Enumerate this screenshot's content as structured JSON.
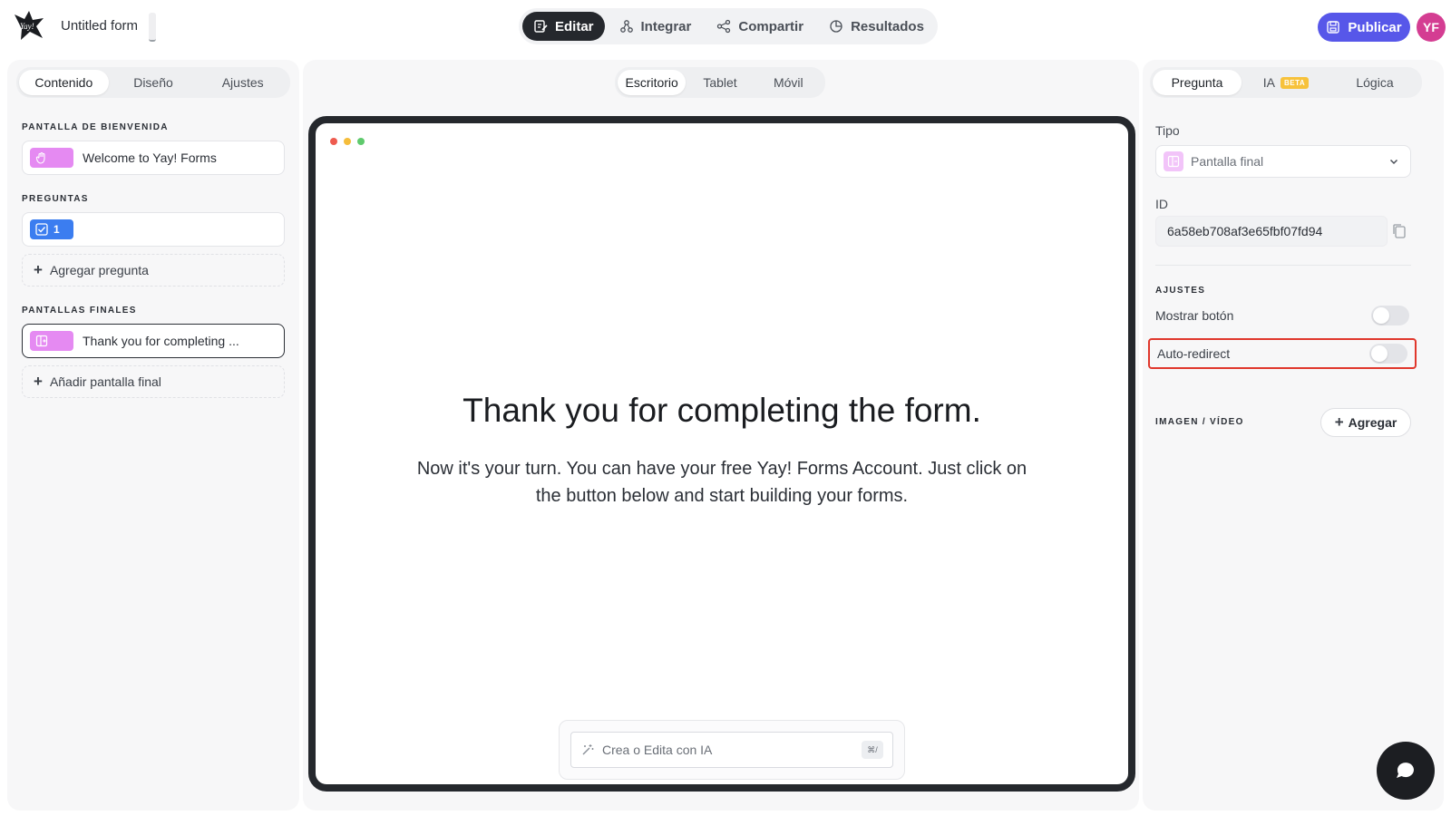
{
  "app": {
    "form_title": "Untitled form"
  },
  "header": {
    "tabs": [
      {
        "label": "Editar",
        "icon": "edit-icon",
        "active": true
      },
      {
        "label": "Integrar",
        "icon": "integrate-icon",
        "active": false
      },
      {
        "label": "Compartir",
        "icon": "share-icon",
        "active": false
      },
      {
        "label": "Resultados",
        "icon": "results-icon",
        "active": false
      }
    ],
    "publish_label": "Publicar",
    "avatar_initials": "YF"
  },
  "left_panel": {
    "tabs": [
      {
        "label": "Contenido",
        "active": true
      },
      {
        "label": "Diseño",
        "active": false
      },
      {
        "label": "Ajustes",
        "active": false
      }
    ],
    "welcome_section": {
      "label": "PANTALLA DE BIENVENIDA",
      "item": "Welcome to Yay! Forms"
    },
    "questions_section": {
      "label": "PREGUNTAS",
      "items": [
        {
          "number": "1",
          "text": ""
        }
      ],
      "add_label": "Agregar pregunta"
    },
    "end_section": {
      "label": "PANTALLAS FINALES",
      "item": "Thank you for completing ...",
      "add_label": "Añadir pantalla final"
    }
  },
  "center": {
    "device_tabs": [
      {
        "label": "Escritorio",
        "active": true
      },
      {
        "label": "Tablet",
        "active": false
      },
      {
        "label": "Móvil",
        "active": false
      }
    ],
    "preview": {
      "heading": "Thank you for completing the form.",
      "body": "Now it's your turn. You can have your free Yay! Forms Account. Just click on the button below and start building your forms."
    },
    "ai_input": {
      "placeholder": "Crea o Edita con IA",
      "shortcut": "⌘/"
    }
  },
  "right_panel": {
    "tabs": [
      {
        "label": "Pregunta",
        "active": true
      },
      {
        "label": "IA",
        "badge": "BETA",
        "active": false
      },
      {
        "label": "Lógica",
        "active": false
      }
    ],
    "type_label": "Tipo",
    "type_value": "Pantalla final",
    "id_label": "ID",
    "id_value": "6a58eb708af3e65fbf07fd94",
    "settings_label": "AJUSTES",
    "toggles": [
      {
        "label": "Mostrar botón",
        "on": false
      },
      {
        "label": "Auto-redirect",
        "on": false
      }
    ],
    "media_label": "IMAGEN / VÍDEO",
    "media_add_label": "Agregar"
  },
  "colors": {
    "accent": "#5757e9",
    "avatar": "#d43d92",
    "welcome_badge": "#e58af2",
    "question_badge": "#3b7df0",
    "highlight": "#e0372c",
    "beta_badge": "#f7c23b"
  }
}
